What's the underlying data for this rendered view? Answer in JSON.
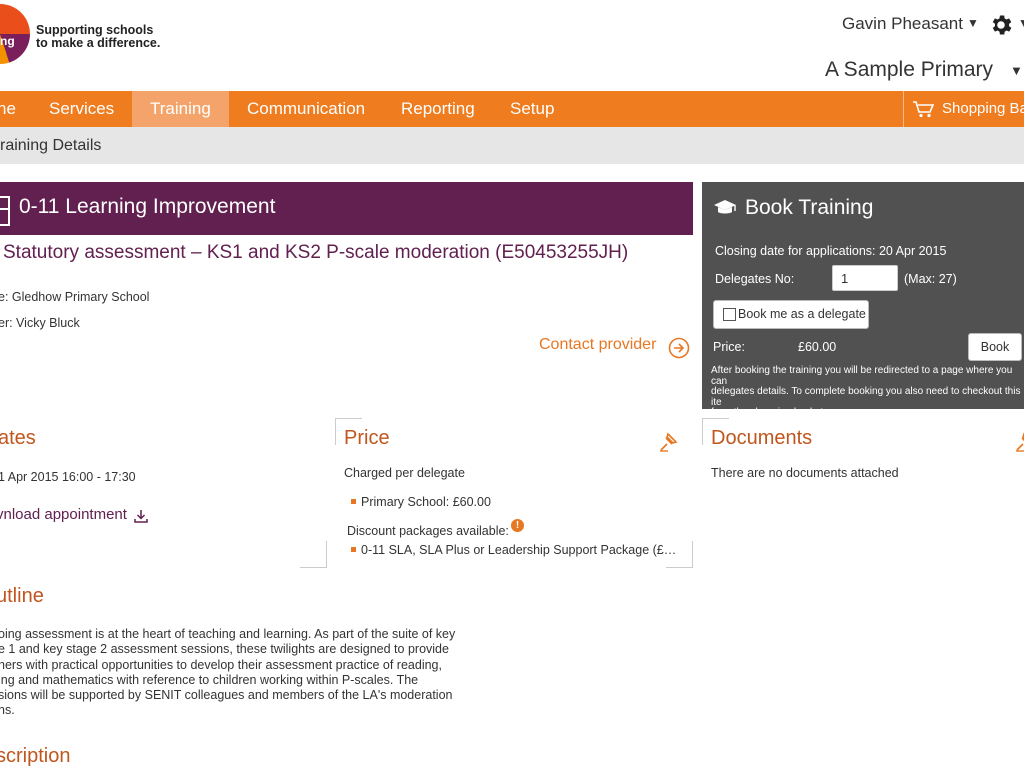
{
  "header": {
    "logo_letter": "ng",
    "tagline_line1": "Supporting schools",
    "tagline_line2": "to make a difference.",
    "user_name": "Gavin Pheasant",
    "school_name": "A Sample Primary"
  },
  "nav": {
    "items": [
      {
        "label": "ne"
      },
      {
        "label": "Services"
      },
      {
        "label": "Training"
      },
      {
        "label": "Communication"
      },
      {
        "label": "Reporting"
      },
      {
        "label": "Setup"
      }
    ],
    "active_item": "Training",
    "basket_label": "Shopping Ba"
  },
  "breadcrumb": "raining Details",
  "course": {
    "category": "0-11 Learning Improvement",
    "title": "Statutory assessment – KS1 and KS2 P-scale moderation (E50453255JH)",
    "venue_line": "e: Gledhow Primary School",
    "trainer_line": "er: Vicky Bluck",
    "contact_label": "Contact provider"
  },
  "book_panel": {
    "title": "Book Training",
    "closing_date": "Closing date for applications: 20 Apr 2015",
    "delegates_label": "Delegates No:",
    "delegates_value": "1",
    "max_label": "(Max: 27)",
    "book_me_label": "Book me as a delegate",
    "price_label": "Price:",
    "price_value": "£60.00",
    "book_button": "Book",
    "note_line1": "After booking the training you will be redirected to a page where you can",
    "note_line2": "delegates details. To complete booking you also need to checkout this ite",
    "note_line3": "from the shopping basket"
  },
  "dates": {
    "heading": "ates",
    "date_line": "1 Apr 2015 16:00 - 17:30",
    "download_label": "vnload appointment"
  },
  "price": {
    "heading": "Price",
    "charged": "Charged per delegate",
    "item": "Primary School: £60.00",
    "discount_label": "Discount packages available:",
    "info_badge": "!",
    "discount_item": "0-11 SLA, SLA Plus or Leadership Support Package (£1…"
  },
  "documents": {
    "heading": "Documents",
    "empty_text": "There are no documents attached"
  },
  "outline": {
    "heading": "utline",
    "lines": [
      "oing assessment is at the heart of teaching and learning. As part of the suite of key",
      "e 1 and key stage 2 assessment sessions, these twilights are designed to provide",
      "hers with practical opportunities to develop their assessment practice of reading,",
      "ing and mathematics with reference to children working within P-scales. The",
      "sions will be supported by SENIT colleagues and members of the LA's moderation",
      "ns."
    ]
  },
  "description": {
    "heading": "scription"
  },
  "colors": {
    "nav_orange": "#ef7c1e",
    "nav_active": "#f4a46a",
    "banner_purple": "#61204f",
    "panel_grey": "#515151",
    "heading_orange": "#c0561e",
    "link_orange": "#e87722"
  }
}
